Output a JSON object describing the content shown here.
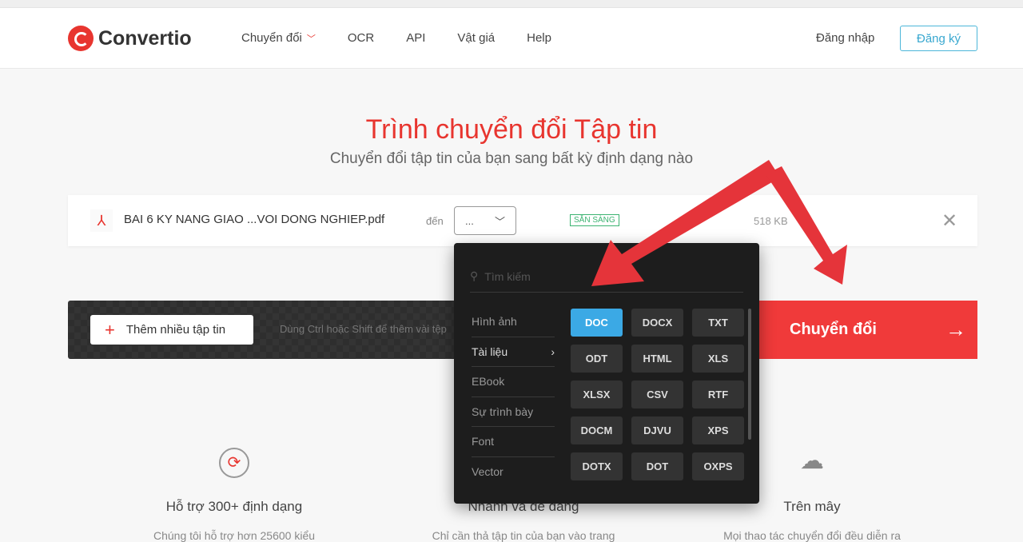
{
  "header": {
    "logo": "Convertio",
    "nav": [
      {
        "label": "Chuyển đổi",
        "has_dropdown": true
      },
      {
        "label": "OCR"
      },
      {
        "label": "API"
      },
      {
        "label": "Vật giá"
      },
      {
        "label": "Help"
      }
    ],
    "login": "Đăng nhập",
    "signup": "Đăng ký"
  },
  "hero": {
    "title": "Trình chuyển đổi Tập tin",
    "subtitle": "Chuyển đổi tập tin của bạn sang bất kỳ định dạng nào"
  },
  "file": {
    "icon": "pdf-icon",
    "name": "BAI 6 KY NANG GIAO ...VOI DONG NGHIEP.pdf",
    "to_label": "đến",
    "format_value": "...",
    "status": "SẴN SÀNG",
    "size": "518 KB"
  },
  "toolbar": {
    "add_label": "Thêm nhiều tập tin",
    "hint": "Dùng Ctrl hoặc Shift để thêm vài tệp",
    "convert_label": "Chuyển đổi"
  },
  "dropdown": {
    "search_placeholder": "Tìm kiếm",
    "categories": [
      "Hình ảnh",
      "Tài liệu",
      "EBook",
      "Sự trình bày",
      "Font",
      "Vector"
    ],
    "active_category": "Tài liệu",
    "formats": [
      "DOC",
      "DOCX",
      "TXT",
      "ODT",
      "HTML",
      "XLS",
      "XLSX",
      "CSV",
      "RTF",
      "DOCM",
      "DJVU",
      "XPS",
      "DOTX",
      "DOT",
      "OXPS"
    ],
    "selected_format": "DOC"
  },
  "features": [
    {
      "icon": "refresh-icon",
      "title": "Hỗ trợ 300+ định dạng",
      "desc": "Chúng tôi hỗ trợ hơn 25600 kiểu"
    },
    {
      "icon": "speed-icon",
      "title": "Nhanh và dễ dàng",
      "desc": "Chỉ cần thả tập tin của bạn vào trang"
    },
    {
      "icon": "cloud-upload-icon",
      "title": "Trên mây",
      "desc": "Mọi thao tác chuyển đổi đều diễn ra"
    }
  ],
  "colors": {
    "brand": "#e8352f",
    "accent": "#3ba9e5",
    "annotation_arrow": "#e5343a"
  }
}
